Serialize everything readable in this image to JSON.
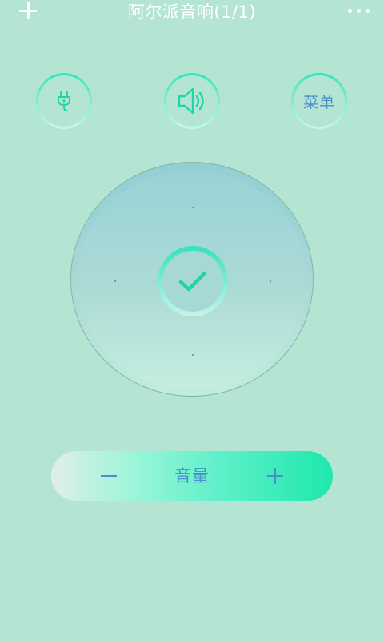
{
  "header": {
    "title": "阿尔派音响(1/1)",
    "add_icon": "plus-icon",
    "more_icon": "more-dots-icon"
  },
  "controls": {
    "power_icon": "power-plug-icon",
    "mute_icon": "speaker-icon",
    "menu_label": "菜单"
  },
  "dpad": {
    "ok_icon": "checkmark-icon"
  },
  "volume": {
    "label": "音量",
    "minus_icon": "minus-icon",
    "plus_icon": "plus-icon"
  },
  "colors": {
    "background": "#b3e5d2",
    "accent": "#1ee8ad",
    "text_blue": "#4a90c8"
  }
}
